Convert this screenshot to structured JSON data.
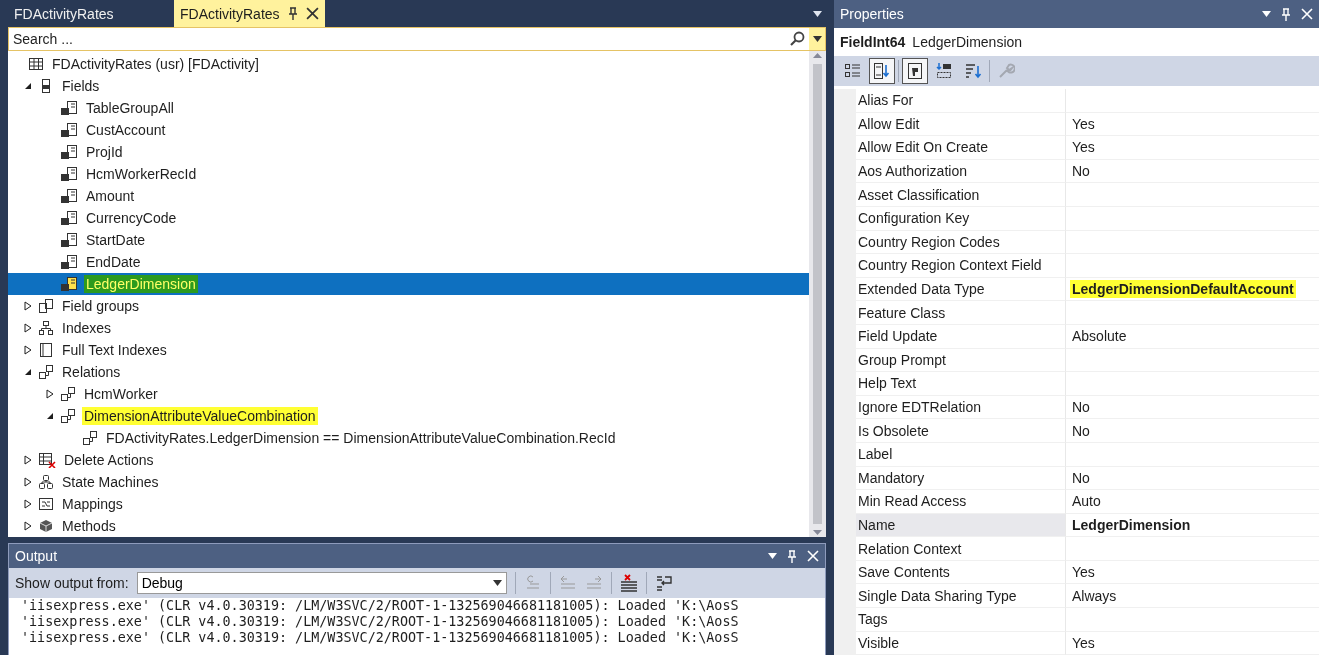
{
  "document_tabs": [
    {
      "label": "FDActivityRates",
      "selected": false
    },
    {
      "label": "FDActivityRates",
      "selected": true
    }
  ],
  "search": {
    "placeholder": "Search ..."
  },
  "tree": [
    {
      "label": "FDActivityRates (usr) [FDActivity]",
      "kind": "table",
      "selected": false,
      "highlighted": false,
      "children": [
        {
          "label": "Fields",
          "kind": "fields",
          "expanded": true,
          "selected": false,
          "highlighted": false,
          "children": [
            {
              "label": "TableGroupAll",
              "kind": "field",
              "selected": false,
              "highlighted": false
            },
            {
              "label": "CustAccount",
              "kind": "field",
              "selected": false,
              "highlighted": false
            },
            {
              "label": "ProjId",
              "kind": "field",
              "selected": false,
              "highlighted": false
            },
            {
              "label": "HcmWorkerRecId",
              "kind": "field",
              "selected": false,
              "highlighted": false
            },
            {
              "label": "Amount",
              "kind": "field",
              "selected": false,
              "highlighted": false
            },
            {
              "label": "CurrencyCode",
              "kind": "field",
              "selected": false,
              "highlighted": false
            },
            {
              "label": "StartDate",
              "kind": "field",
              "selected": false,
              "highlighted": false
            },
            {
              "label": "EndDate",
              "kind": "field",
              "selected": false,
              "highlighted": false
            },
            {
              "label": "LedgerDimension",
              "kind": "field",
              "selected": true,
              "highlighted": true
            }
          ]
        },
        {
          "label": "Field groups",
          "kind": "field-groups",
          "expanded": false,
          "selected": false,
          "highlighted": false
        },
        {
          "label": "Indexes",
          "kind": "indexes",
          "expanded": false,
          "selected": false,
          "highlighted": false
        },
        {
          "label": "Full Text Indexes",
          "kind": "full-text",
          "expanded": false,
          "selected": false,
          "highlighted": false
        },
        {
          "label": "Relations",
          "kind": "relation",
          "expanded": true,
          "selected": false,
          "highlighted": false,
          "children": [
            {
              "label": "HcmWorker",
              "kind": "relation",
              "expanded": false,
              "selected": false,
              "highlighted": false
            },
            {
              "label": "DimensionAttributeValueCombination",
              "kind": "relation",
              "expanded": true,
              "selected": false,
              "highlighted": true,
              "children": [
                {
                  "label": "FDActivityRates.LedgerDimension == DimensionAttributeValueCombination.RecId",
                  "kind": "relation",
                  "selected": false,
                  "highlighted": false
                }
              ]
            }
          ]
        },
        {
          "label": "Delete Actions",
          "kind": "delete-actions",
          "expanded": false,
          "selected": false,
          "highlighted": false
        },
        {
          "label": "State Machines",
          "kind": "state-machines",
          "expanded": false,
          "selected": false,
          "highlighted": false
        },
        {
          "label": "Mappings",
          "kind": "mappings",
          "expanded": false,
          "selected": false,
          "highlighted": false
        },
        {
          "label": "Methods",
          "kind": "methods",
          "expanded": false,
          "selected": false,
          "highlighted": false
        }
      ]
    }
  ],
  "output": {
    "title": "Output",
    "source_label": "Show output from:",
    "source": "Debug",
    "lines": [
      "'iisexpress.exe' (CLR v4.0.30319: /LM/W3SVC/2/ROOT-1-132569046681181005): Loaded 'K:\\AosS",
      "'iisexpress.exe' (CLR v4.0.30319: /LM/W3SVC/2/ROOT-1-132569046681181005): Loaded 'K:\\AosS",
      "'iisexpress.exe' (CLR v4.0.30319: /LM/W3SVC/2/ROOT-1-132569046681181005): Loaded 'K:\\AosS"
    ]
  },
  "properties": {
    "title": "Properties",
    "object_type": "FieldInt64",
    "object_name": "LedgerDimension",
    "toolbar": [
      {
        "kind": "categorized",
        "pressed": false,
        "disabled": false
      },
      {
        "kind": "alphabetical",
        "pressed": true,
        "disabled": false
      },
      {
        "kind": "properties",
        "pressed": true,
        "disabled": false
      },
      {
        "kind": "events",
        "pressed": false,
        "disabled": false
      },
      {
        "kind": "sort",
        "pressed": false,
        "disabled": false
      },
      {
        "kind": "wrench",
        "pressed": false,
        "disabled": true
      }
    ],
    "rows": [
      {
        "name": "Alias For",
        "selected": false
      },
      {
        "name": "Allow Edit",
        "value": "Yes",
        "selected": false,
        "bold": false,
        "highlighted": false
      },
      {
        "name": "Allow Edit On Create",
        "value": "Yes",
        "selected": false,
        "bold": false,
        "highlighted": false
      },
      {
        "name": "Aos Authorization",
        "value": "No",
        "selected": false,
        "bold": false,
        "highlighted": false
      },
      {
        "name": "Asset Classification",
        "selected": false
      },
      {
        "name": "Configuration Key",
        "selected": false
      },
      {
        "name": "Country Region Codes",
        "selected": false
      },
      {
        "name": "Country Region Context Field",
        "selected": false
      },
      {
        "name": "Extended Data Type",
        "value": "LedgerDimensionDefaultAccount",
        "selected": false,
        "bold": true,
        "highlighted": true
      },
      {
        "name": "Feature Class",
        "selected": false
      },
      {
        "name": "Field Update",
        "value": "Absolute",
        "selected": false,
        "bold": false,
        "highlighted": false
      },
      {
        "name": "Group Prompt",
        "selected": false
      },
      {
        "name": "Help Text",
        "selected": false
      },
      {
        "name": "Ignore EDTRelation",
        "value": "No",
        "selected": false,
        "bold": false,
        "highlighted": false
      },
      {
        "name": "Is Obsolete",
        "value": "No",
        "selected": false,
        "bold": false,
        "highlighted": false
      },
      {
        "name": "Label",
        "selected": false
      },
      {
        "name": "Mandatory",
        "value": "No",
        "selected": false,
        "bold": false,
        "highlighted": false
      },
      {
        "name": "Min Read Access",
        "value": "Auto",
        "selected": false,
        "bold": false,
        "highlighted": false
      },
      {
        "name": "Name",
        "value": "LedgerDimension",
        "selected": true,
        "bold": true,
        "highlighted": false
      },
      {
        "name": "Relation Context",
        "selected": false
      },
      {
        "name": "Save Contents",
        "value": "Yes",
        "selected": false,
        "bold": false,
        "highlighted": false
      },
      {
        "name": "Single Data Sharing Type",
        "value": "Always",
        "selected": false,
        "bold": false,
        "highlighted": false
      },
      {
        "name": "Tags",
        "selected": false
      },
      {
        "name": "Visible",
        "value": "Yes",
        "selected": false,
        "bold": false,
        "highlighted": false
      }
    ]
  }
}
